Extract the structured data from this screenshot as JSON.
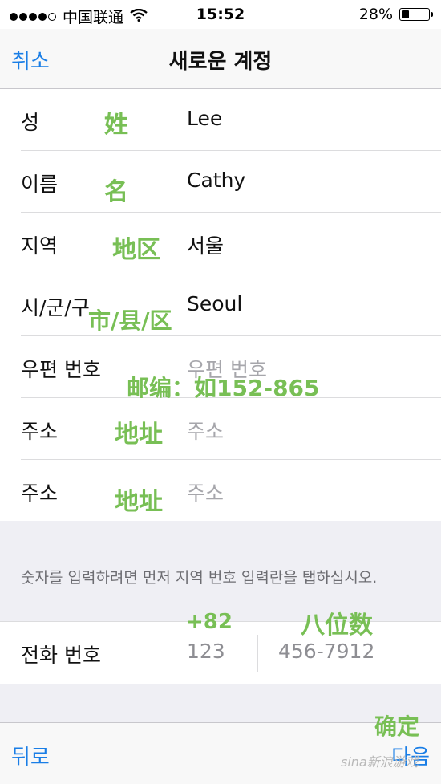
{
  "status_bar": {
    "carrier": "中国联通",
    "time": "15:52",
    "battery": "28%",
    "battery_level": 0.28
  },
  "nav": {
    "cancel_label": "취소",
    "title": "새로운 계정"
  },
  "form": {
    "rows": [
      {
        "label": "성",
        "value": "Lee",
        "placeholder": false
      },
      {
        "label": "이름",
        "value": "Cathy",
        "placeholder": false
      },
      {
        "label": "지역",
        "value": "서울",
        "placeholder": false
      },
      {
        "label": "시/군/구",
        "value": "Seoul",
        "placeholder": false
      },
      {
        "label": "우편 번호",
        "value": "우편 번호",
        "placeholder": true
      },
      {
        "label": "주소",
        "value": "주소",
        "placeholder": true
      },
      {
        "label": "주소",
        "value": "주소",
        "placeholder": true
      }
    ]
  },
  "hint": "숫자를 입력하려면 먼저 지역 번호 입력란을 탭하십시오.",
  "phone": {
    "label": "전화 번호",
    "area_code": "123",
    "number": "456-7912"
  },
  "bottom": {
    "back_label": "뒤로",
    "next_label": "다음"
  },
  "annotations": {
    "surname": "姓",
    "given_name": "名",
    "region": "地区",
    "city": "市/县/区",
    "postcode": "邮编：如152-865",
    "address_1": "地址",
    "address_2": "地址",
    "country_code": "+82",
    "eight_digits": "八位数",
    "confirm": "确定"
  },
  "watermark": "sina新浪游戏",
  "colors": {
    "accent": "#1a7ee6",
    "annotation": "#78bf55",
    "grouped_bg": "#efeff4"
  }
}
